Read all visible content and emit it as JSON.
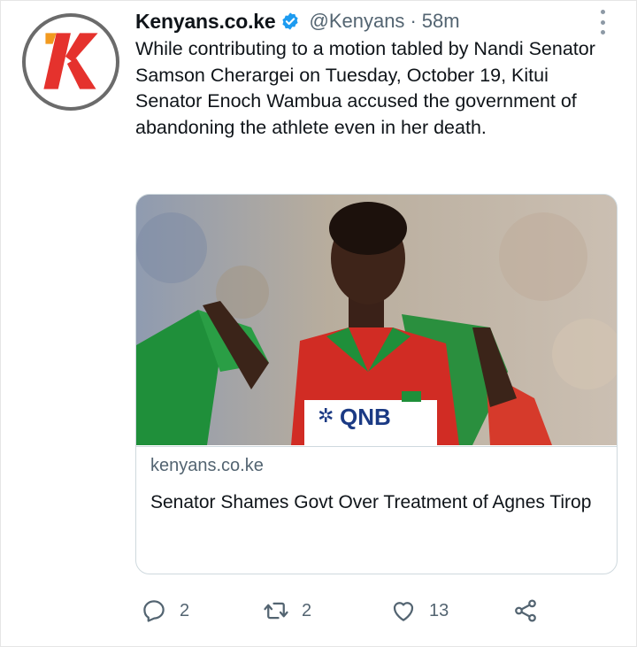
{
  "tweet": {
    "display_name": "Kenyans.co.ke",
    "handle": "@Kenyans",
    "separator": "·",
    "time": "58m",
    "text": "While contributing to a motion tabled by Nandi Senator Samson Cherargei on Tuesday, October 19, Kitui Senator Enoch Wambua accused the government of abandoning the athlete even in her death."
  },
  "card": {
    "domain": "kenyans.co.ke",
    "title": "Senator Shames Govt Over Treatment of Agnes Tirop",
    "image_bib_text": "QNB"
  },
  "actions": {
    "reply_count": "2",
    "retweet_count": "2",
    "like_count": "13"
  },
  "icons": {
    "avatar": "kenyans-k-logo",
    "verified": "verified-badge-icon",
    "more": "more-options-icon",
    "reply": "reply-icon",
    "retweet": "retweet-icon",
    "like": "heart-icon",
    "share": "share-icon"
  },
  "colors": {
    "text": "#0f1419",
    "muted": "#536471",
    "verified": "#1d9bf0",
    "logo_red": "#e5322d",
    "logo_orange": "#f29a1f"
  }
}
